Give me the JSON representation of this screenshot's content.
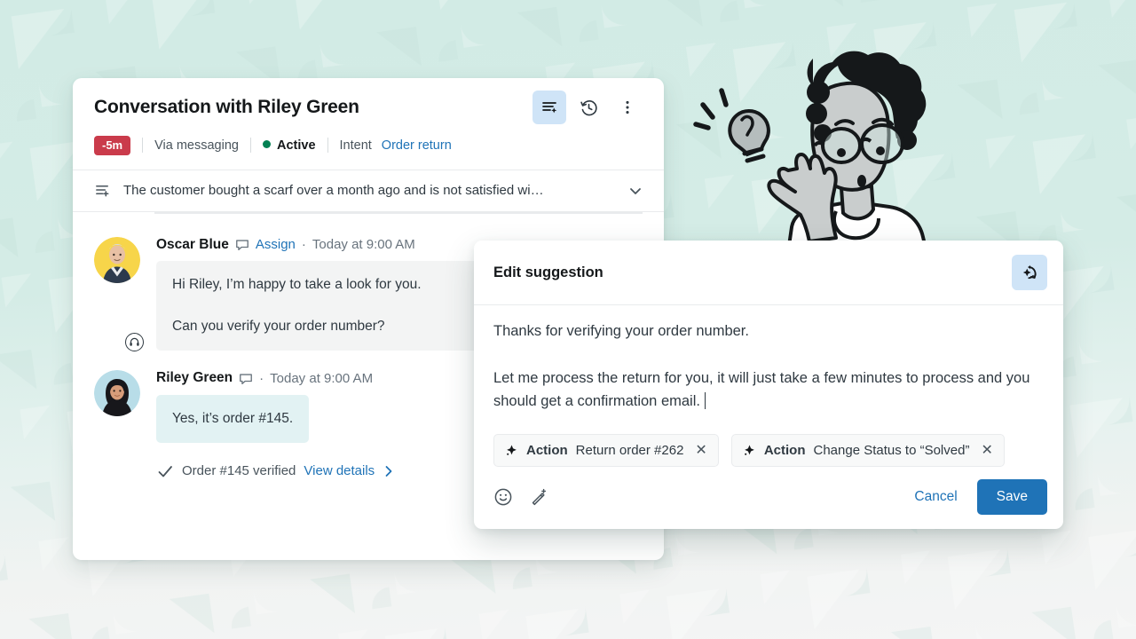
{
  "theme": {
    "background_top": "#d2ebe5",
    "background_bottom": "#f4f5f5",
    "accent_blue": "#1f73b7",
    "badge_red": "#ca3b4b",
    "status_green": "#038153",
    "agent_bubble": "#f3f4f4",
    "customer_bubble": "#e2f2f3",
    "icon_button_active": "#cfe4f7"
  },
  "conversation": {
    "title": "Conversation with Riley Green",
    "sla_badge": "-5m",
    "channel": "Via messaging",
    "status": "Active",
    "intent_label": "Intent",
    "intent_value": "Order return",
    "header_actions": [
      {
        "name": "summarize-icon",
        "label": "Summarize"
      },
      {
        "name": "history-icon",
        "label": "History"
      },
      {
        "name": "more-options-icon",
        "label": "More options"
      }
    ],
    "summary": {
      "icon": "summary-icon",
      "text": "The customer bought a scarf over a month ago and is not satisfied wi…",
      "expand_icon": "chevron-down-icon"
    },
    "messages": [
      {
        "author": "Oscar Blue",
        "avatar_type": "agent-avatar",
        "avatar_bg": "#f7d54a",
        "channel_icon": "comment-icon",
        "assign_link": "Assign",
        "separator": "·",
        "timestamp": "Today at 9:00 AM",
        "bubble_style": "agent",
        "paragraphs": [
          "Hi Riley, I’m happy to take a look for you.",
          "Can you verify your order number?"
        ]
      },
      {
        "author": "Riley Green",
        "avatar_type": "customer-avatar",
        "avatar_bg": "#b8dde8",
        "channel_icon": "comment-icon",
        "assign_link": "",
        "separator": "·",
        "timestamp": "Today at 9:00 AM",
        "bubble_style": "customer",
        "paragraphs": [
          "Yes, it’s order #145."
        ]
      }
    ],
    "event": {
      "icon": "check-icon",
      "text": "Order #145 verified",
      "link": "View details",
      "link_icon": "chevron-right-icon"
    }
  },
  "edit_suggestion": {
    "title": "Edit suggestion",
    "regenerate_icon": "regenerate-sparkle-icon",
    "paragraphs": [
      "Thanks for verifying your order number.",
      "Let me process the return for you, it will just take a few minutes to process and you should get a confirmation email."
    ],
    "action_chips": [
      {
        "icon": "sparkle-icon",
        "label": "Action",
        "value": "Return order #262",
        "remove_icon": "close-icon"
      },
      {
        "icon": "sparkle-icon",
        "label": "Action",
        "value": "Change Status to “Solved”",
        "remove_icon": "close-icon"
      }
    ],
    "footer_tools": [
      {
        "name": "emoji-icon",
        "label": "Insert emoji"
      },
      {
        "name": "magic-wand-icon",
        "label": "AI tools"
      }
    ],
    "cancel_label": "Cancel",
    "save_label": "Save"
  },
  "illustration": {
    "name": "person-with-lightbulb-illustration",
    "description": "Person with curly hair and glasses thinking next to a lightbulb"
  }
}
